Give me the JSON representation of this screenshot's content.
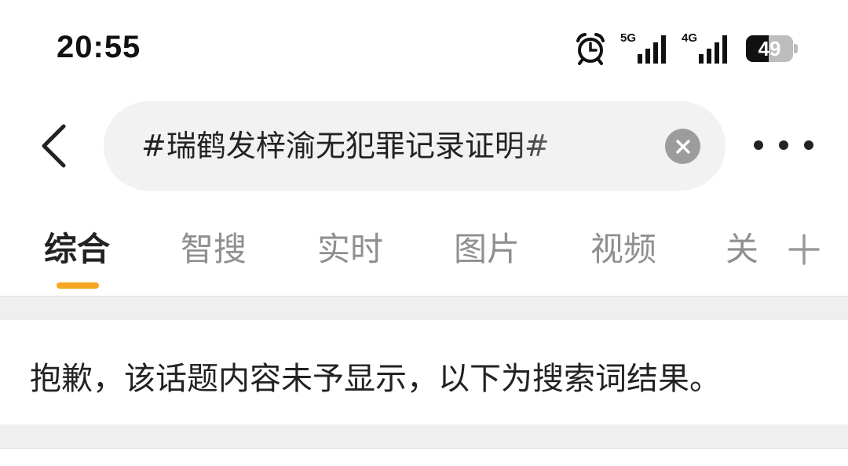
{
  "status_bar": {
    "time": "20:55",
    "signal_1_label": "5G",
    "signal_2_label": "4G",
    "battery_percent": "49",
    "battery_level": 0.49,
    "icons": [
      "alarm-icon",
      "signal-5g-icon",
      "signal-4g-icon",
      "battery-icon"
    ]
  },
  "header": {
    "back_icon": "chevron-left-icon",
    "search_query": "#瑞鹤发梓渝无犯罪记录证明#",
    "clear_icon": "close-icon",
    "more_icon": "ellipsis-icon"
  },
  "tabs": {
    "items": [
      {
        "label": "综合",
        "active": true
      },
      {
        "label": "智搜",
        "active": false
      },
      {
        "label": "实时",
        "active": false
      },
      {
        "label": "图片",
        "active": false
      },
      {
        "label": "视频",
        "active": false
      },
      {
        "label": "关",
        "active": false
      }
    ],
    "add_icon": "plus-icon",
    "accent_color": "#f5a623"
  },
  "notice": {
    "text": "抱歉，该话题内容未予显示，以下为搜索词结果。"
  }
}
